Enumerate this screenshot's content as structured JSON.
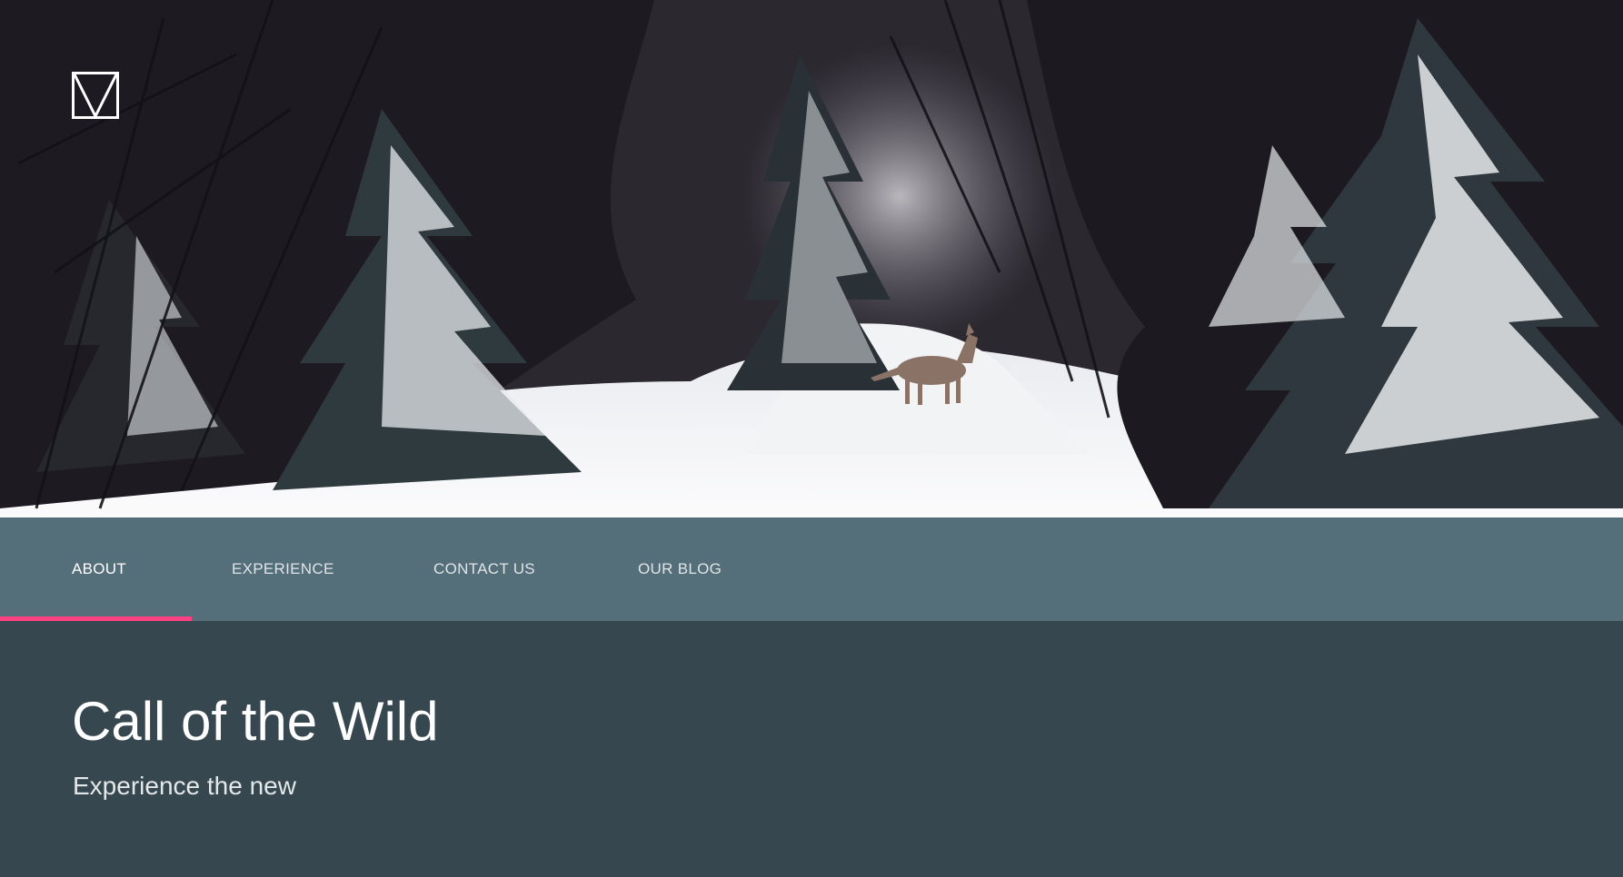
{
  "brand": {
    "logo_icon": "m-logo-icon",
    "color": "#ffffff"
  },
  "hero": {
    "image": "snowy-forest-wolf-photo"
  },
  "nav": {
    "background": "#546e7a",
    "indicator_color": "#ff4081",
    "active_index": 0,
    "tabs": [
      {
        "label": "ABOUT"
      },
      {
        "label": "EXPERIENCE"
      },
      {
        "label": "CONTACT US"
      },
      {
        "label": "OUR BLOG"
      }
    ]
  },
  "content": {
    "background": "#37474f",
    "title": "Call of the Wild",
    "subtitle": "Experience the new"
  }
}
